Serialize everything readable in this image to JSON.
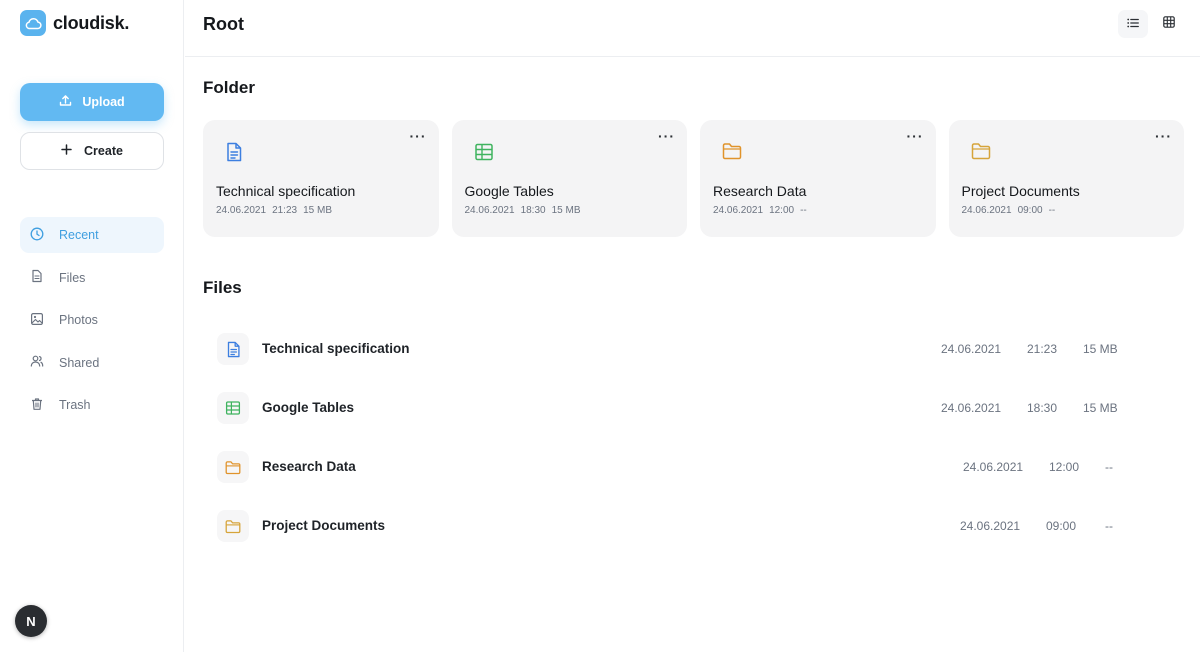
{
  "brand": {
    "name": "cloudisk.",
    "icon": "cloud-icon"
  },
  "sidebar": {
    "upload_label": "Upload",
    "create_label": "Create",
    "items": [
      {
        "label": "Recent",
        "icon": "clock-icon",
        "active": true
      },
      {
        "label": "Files",
        "icon": "file-icon",
        "active": false
      },
      {
        "label": "Photos",
        "icon": "image-icon",
        "active": false
      },
      {
        "label": "Shared",
        "icon": "users-icon",
        "active": false
      },
      {
        "label": "Trash",
        "icon": "trash-icon",
        "active": false
      }
    ],
    "avatar_initial": "N"
  },
  "header": {
    "title": "Root",
    "view_list_icon": "list-view-icon",
    "view_grid_icon": "grid-view-icon"
  },
  "folders": {
    "title": "Folder",
    "items": [
      {
        "name": "Technical specification",
        "date": "24.06.2021",
        "time": "21:23",
        "size": "15 MB",
        "icon": "document-icon"
      },
      {
        "name": "Google Tables",
        "date": "24.06.2021",
        "time": "18:30",
        "size": "15 MB",
        "icon": "spreadsheet-icon"
      },
      {
        "name": "Research Data",
        "date": "24.06.2021",
        "time": "12:00",
        "size": "--",
        "icon": "folder-icon"
      },
      {
        "name": "Project Documents",
        "date": "24.06.2021",
        "time": "09:00",
        "size": "--",
        "icon": "folder-icon"
      }
    ]
  },
  "files": {
    "title": "Files",
    "items": [
      {
        "name": "Technical specification",
        "date": "24.06.2021",
        "time": "21:23",
        "size": "15 MB",
        "icon": "document-icon"
      },
      {
        "name": "Google Tables",
        "date": "24.06.2021",
        "time": "18:30",
        "size": "15 MB",
        "icon": "spreadsheet-icon"
      },
      {
        "name": "Research Data",
        "date": "24.06.2021",
        "time": "12:00",
        "size": "--",
        "icon": "folder-icon"
      },
      {
        "name": "Project Documents",
        "date": "24.06.2021",
        "time": "09:00",
        "size": "--",
        "icon": "folder-icon"
      }
    ]
  },
  "colors": {
    "accent": "#62b9f2",
    "document": "#3d7fe0",
    "spreadsheet": "#3fb35f",
    "folder": "#e0932b",
    "folder_alt": "#d6a43a"
  }
}
